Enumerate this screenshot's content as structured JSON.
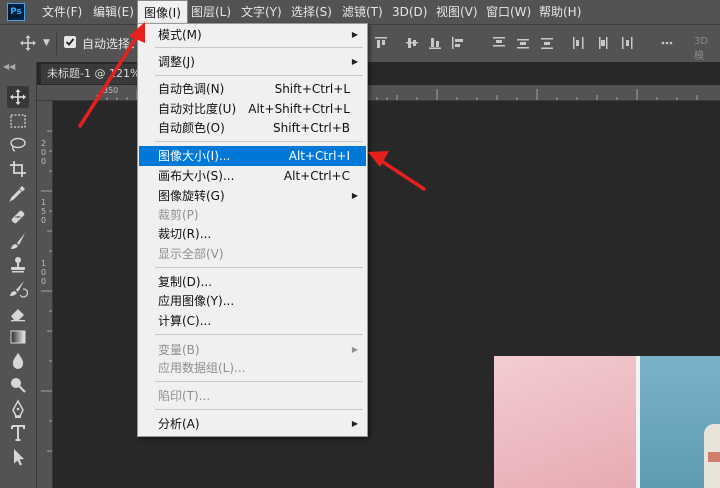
{
  "app": {
    "logo": "Ps"
  },
  "menubar": {
    "items": [
      {
        "label": "文件(F)"
      },
      {
        "label": "编辑(E)"
      },
      {
        "label": "图像(I)"
      },
      {
        "label": "图层(L)"
      },
      {
        "label": "文字(Y)"
      },
      {
        "label": "选择(S)"
      },
      {
        "label": "滤镜(T)"
      },
      {
        "label": "3D(D)"
      },
      {
        "label": "视图(V)"
      },
      {
        "label": "窗口(W)"
      },
      {
        "label": "帮助(H)"
      }
    ],
    "active_index": 2
  },
  "options_bar": {
    "auto_select_label": "自动选择：",
    "auto_select_checked": true,
    "right_label": "3D 模"
  },
  "document": {
    "tab_title": "未标题-1 @ 121%",
    "ruler_top_label": "350",
    "ruler_left_labels": [
      "200",
      "150",
      "100"
    ]
  },
  "image_menu": {
    "items": [
      {
        "label": "模式(M)",
        "shortcut": "",
        "submenu": true,
        "enabled": true
      },
      {
        "label": "调整(J)",
        "shortcut": "",
        "submenu": true,
        "enabled": true
      },
      {
        "label": "自动色调(N)",
        "shortcut": "Shift+Ctrl+L",
        "submenu": false,
        "enabled": true
      },
      {
        "label": "自动对比度(U)",
        "shortcut": "Alt+Shift+Ctrl+L",
        "submenu": false,
        "enabled": true
      },
      {
        "label": "自动颜色(O)",
        "shortcut": "Shift+Ctrl+B",
        "submenu": false,
        "enabled": true
      },
      {
        "label": "图像大小(I)...",
        "shortcut": "Alt+Ctrl+I",
        "submenu": false,
        "enabled": true,
        "highlighted": true
      },
      {
        "label": "画布大小(S)...",
        "shortcut": "Alt+Ctrl+C",
        "submenu": false,
        "enabled": true
      },
      {
        "label": "图像旋转(G)",
        "shortcut": "",
        "submenu": true,
        "enabled": true
      },
      {
        "label": "裁剪(P)",
        "shortcut": "",
        "submenu": false,
        "enabled": false
      },
      {
        "label": "裁切(R)...",
        "shortcut": "",
        "submenu": false,
        "enabled": true
      },
      {
        "label": "显示全部(V)",
        "shortcut": "",
        "submenu": false,
        "enabled": false
      },
      {
        "label": "复制(D)...",
        "shortcut": "",
        "submenu": false,
        "enabled": true
      },
      {
        "label": "应用图像(Y)...",
        "shortcut": "",
        "submenu": false,
        "enabled": true
      },
      {
        "label": "计算(C)...",
        "shortcut": "",
        "submenu": false,
        "enabled": true
      },
      {
        "label": "变量(B)",
        "shortcut": "",
        "submenu": true,
        "enabled": false
      },
      {
        "label": "应用数据组(L)...",
        "shortcut": "",
        "submenu": false,
        "enabled": false
      },
      {
        "label": "陷印(T)...",
        "shortcut": "",
        "submenu": false,
        "enabled": false
      },
      {
        "label": "分析(A)",
        "shortcut": "",
        "submenu": true,
        "enabled": true
      }
    ]
  },
  "toolbar": {
    "tools": [
      "move-icon",
      "marquee-icon",
      "lasso-icon",
      "crop-icon",
      "eyedropper-icon",
      "healing-brush-icon",
      "brush-icon",
      "clone-stamp-icon",
      "history-brush-icon",
      "eraser-icon",
      "gradient-icon",
      "blur-icon",
      "dodge-icon",
      "pen-icon",
      "type-icon",
      "path-select-icon"
    ]
  },
  "colors": {
    "menu_highlight": "#0078d7",
    "annotation_arrow": "#e8201d",
    "ui_panel": "#535353",
    "workspace": "#282828"
  }
}
